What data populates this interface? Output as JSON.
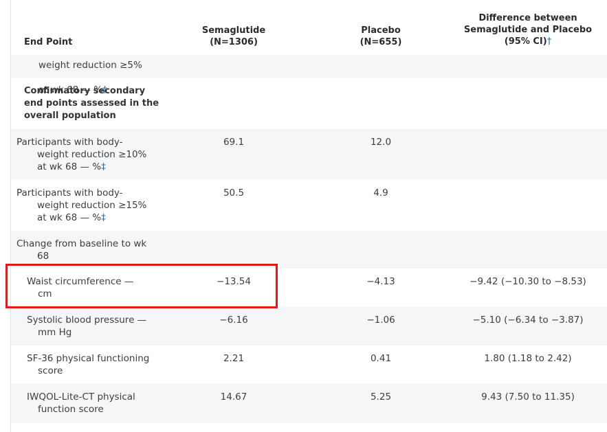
{
  "header": {
    "col1": "End Point",
    "col2_line1": "Semaglutide",
    "col2_line2": "(N=1306)",
    "col3_line1": "Placebo",
    "col3_line2": "(N=655)",
    "col4_line1": "Difference between",
    "col4_line2": "Semaglutide and Placebo",
    "col4_line3": "(95% CI)",
    "col4_dagger": "†"
  },
  "partial_row": {
    "line1": "weight reduction ≥5%",
    "line2": "at wk 68 — %",
    "mark": "‡"
  },
  "section_heading": {
    "line1": "Confirmatory secondary",
    "line2": "end points assessed in the",
    "line3": "overall population"
  },
  "rows": [
    {
      "l1": "Participants with body-",
      "l2": "weight reduction ≥10%",
      "l3": "at wk 68 — %",
      "mark": "‡",
      "sema": "69.1",
      "placebo": "12.0",
      "diff": ""
    },
    {
      "l1": "Participants with body-",
      "l2": "weight reduction ≥15%",
      "l3": "at wk 68 — %",
      "mark": "‡",
      "sema": "50.5",
      "placebo": "4.9",
      "diff": ""
    }
  ],
  "change_heading": {
    "line1": "Change from baseline to wk",
    "line2": "68"
  },
  "subrows": [
    {
      "l1": "Waist circumference —",
      "l2": "cm",
      "sema": "−13.54",
      "placebo": "−4.13",
      "diff": "−9.42 (−10.30 to −8.53)"
    },
    {
      "l1": "Systolic blood pressure —",
      "l2": "mm Hg",
      "sema": "−6.16",
      "placebo": "−1.06",
      "diff": "−5.10 (−6.34 to −3.87)"
    },
    {
      "l1": "SF-36 physical functioning",
      "l2": "score",
      "sema": "2.21",
      "placebo": "0.41",
      "diff": "1.80 (1.18 to 2.42)"
    },
    {
      "l1": "IWQOL-Lite-CT physical",
      "l2": "function score",
      "sema": "14.67",
      "placebo": "5.25",
      "diff": "9.43 (7.50 to 11.35)"
    }
  ],
  "colors": {
    "highlight": "#e01919",
    "shade": "#f5f6f7",
    "link": "#2a6db0"
  }
}
